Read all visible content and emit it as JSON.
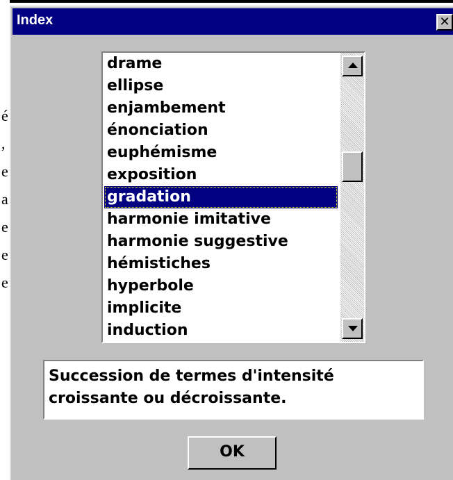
{
  "window": {
    "title": "Index",
    "close_label": "✕"
  },
  "background_text": [
    "é",
    ",",
    "e",
    "a",
    "e",
    "e",
    "e"
  ],
  "list": {
    "items": [
      "drame",
      "ellipse",
      "enjambement",
      "énonciation",
      "euphémisme",
      "exposition",
      "gradation",
      "harmonie imitative",
      "harmonie suggestive",
      "hémistiches",
      "hyperbole",
      "implicite",
      "induction"
    ],
    "selected": "gradation"
  },
  "description": "Succession de termes d'intensité croissante ou décroissante.",
  "buttons": {
    "ok": "OK"
  },
  "colors": {
    "titlebar": "#000080",
    "face": "#c0c0c0",
    "selection": "#000080"
  },
  "icons": {
    "scroll_up": "arrow-up-icon",
    "scroll_down": "arrow-down-icon",
    "close": "close-icon"
  }
}
